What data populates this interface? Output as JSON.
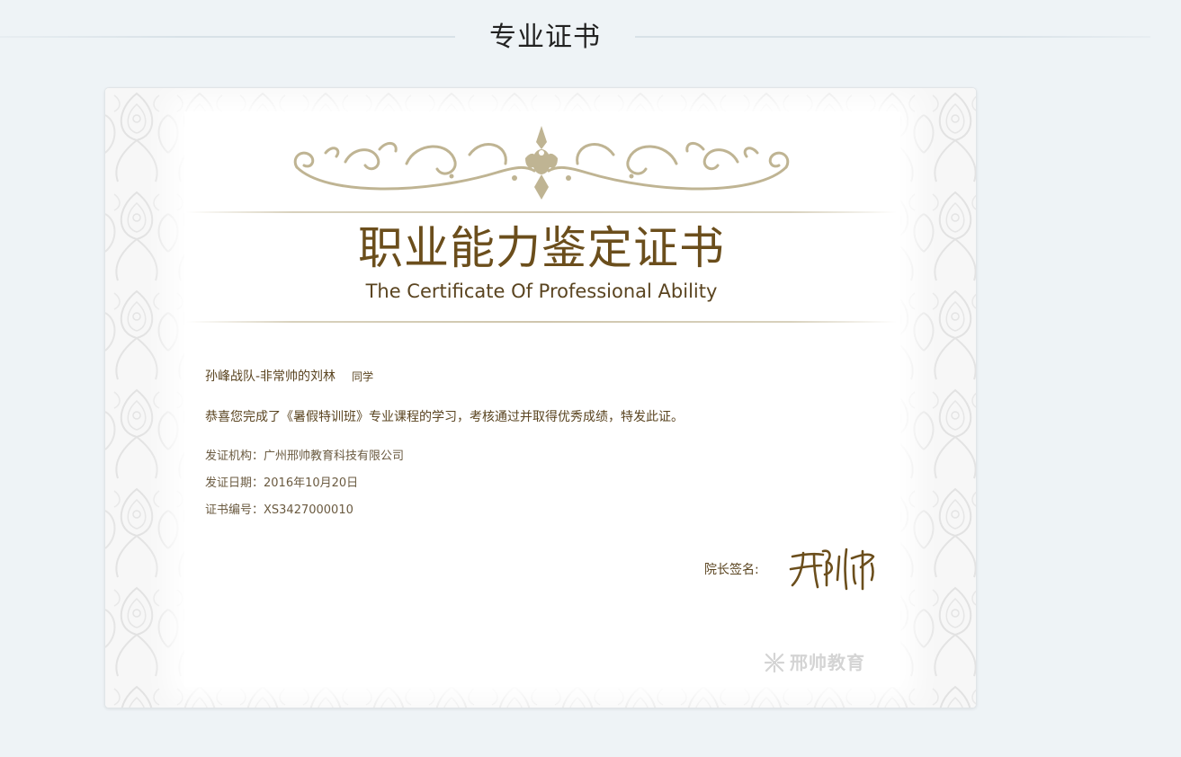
{
  "section": {
    "title": "专业证书"
  },
  "certificate": {
    "title_cn": "职业能力鉴定证书",
    "title_en": "The Certificate Of Professional Ability",
    "recipient_name": "孙峰战队-非常帅的刘林",
    "recipient_suffix": "同学",
    "body": "恭喜您完成了《暑假特训班》专业课程的学习，考核通过并取得优秀成绩，特发此证。",
    "issuer": "发证机构：广州邢帅教育科技有限公司",
    "issue_date": "发证日期：2016年10月20日",
    "cert_number": "证书编号：XS3427000010",
    "signature_label": "院长签名:",
    "signature_text": "邢帅",
    "brand": "邢帅教育"
  },
  "colors": {
    "page_background": "#eef3f6",
    "title_brown": "#6b4e1c",
    "text_brown": "#5a4420",
    "ornament_gold": "#bfb493",
    "watermark_gray": "#d4d4d4"
  },
  "icons": [
    "ornament-flourish",
    "border-damask-pattern",
    "brand-logo-icon",
    "handwritten-signature"
  ]
}
